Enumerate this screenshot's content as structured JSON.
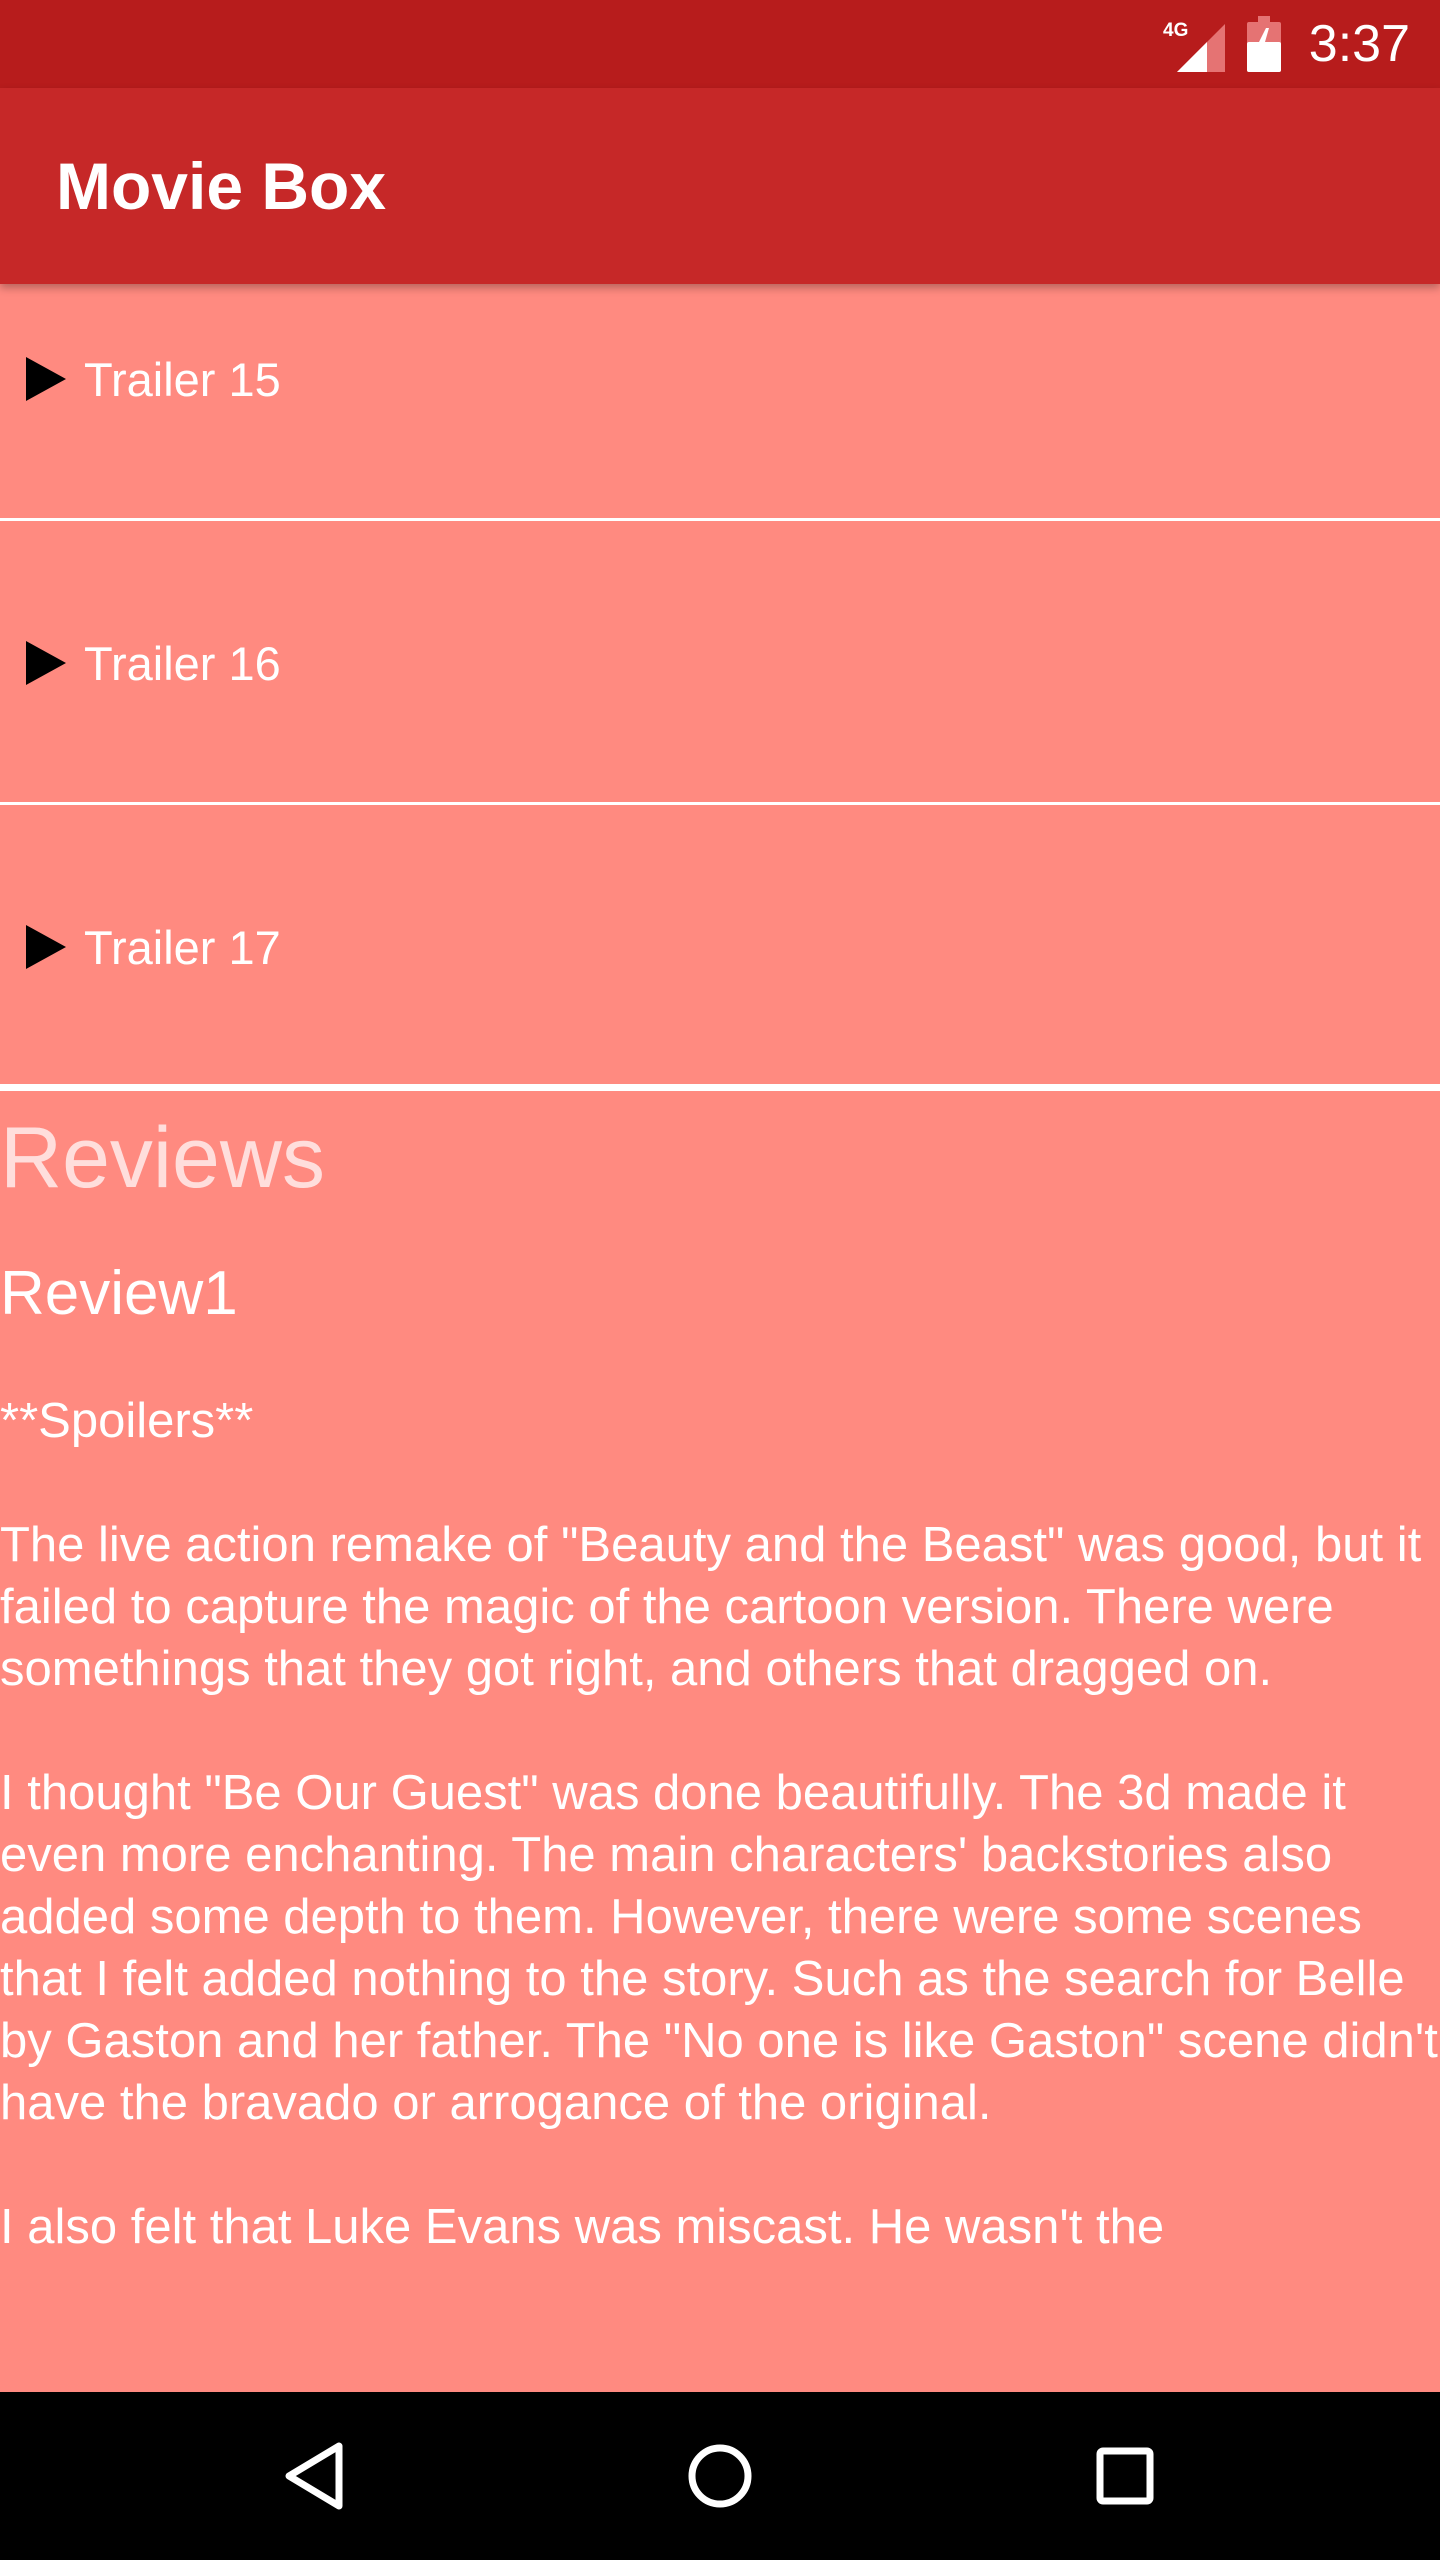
{
  "status_bar": {
    "time": "3:37",
    "network": "4G",
    "icons": [
      "signal-icon",
      "battery-charging-icon"
    ]
  },
  "app_bar": {
    "title": "Movie Box"
  },
  "trailers": [
    {
      "label": "Trailer 15",
      "icon": "play-icon"
    },
    {
      "label": "Trailer 16",
      "icon": "play-icon"
    },
    {
      "label": "Trailer 17",
      "icon": "play-icon"
    }
  ],
  "reviews": {
    "heading": "Reviews",
    "items": [
      {
        "author": "Review1",
        "paragraphs": [
          "**Spoilers**",
          "The live action remake of \"Beauty and the Beast\" was good, but it failed to capture the magic of the cartoon version. There were somethings that they got right, and others that dragged on.",
          "I thought \"Be Our Guest\" was done beautifully. The 3d made it even more enchanting. The main characters' backstories also added some depth to them. However, there were some scenes that I felt added nothing to the story. Such as the search for Belle by Gaston and her father. The \"No one is like Gaston\" scene didn't have the bravado or arrogance of the original.",
          "I also felt that Luke Evans was miscast. He wasn't the"
        ]
      }
    ]
  },
  "nav_bar": {
    "icons": [
      "back-icon",
      "home-icon",
      "recents-icon"
    ]
  },
  "colors": {
    "status_bar": "#B71C1C",
    "app_bar": "#C62828",
    "background": "#FF8A80",
    "text": "#FFFFFF"
  }
}
